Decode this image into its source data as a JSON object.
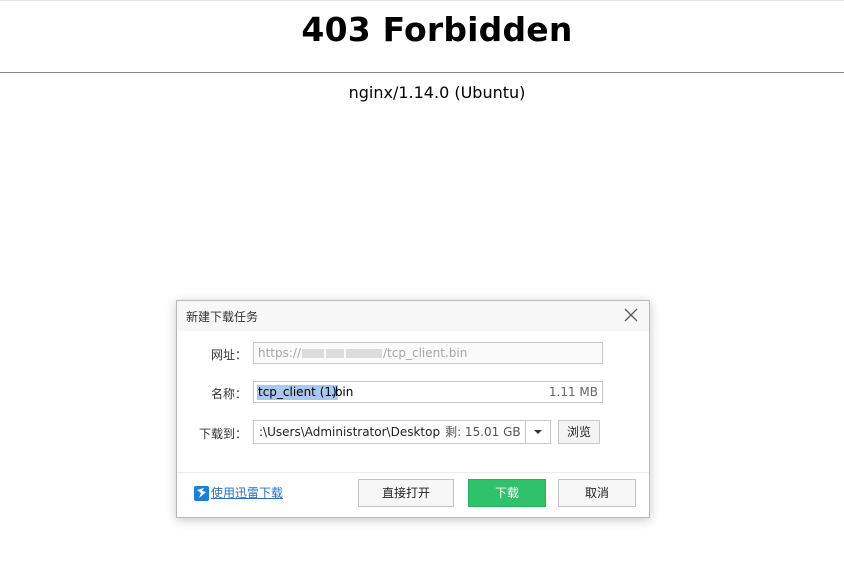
{
  "page": {
    "title": "403 Forbidden",
    "server": "nginx/1.14.0 (Ubuntu)"
  },
  "dialog": {
    "title": "新建下载任务",
    "url_label": "网址：",
    "url_prefix": "https://",
    "url_suffix": "/tcp_client.bin",
    "name_label": "名称：",
    "name_selected": "tcp_client (1)",
    "name_ext": ".bin",
    "file_size": "1.11 MB",
    "path_label": "下载到：",
    "path_value": ":\\Users\\Administrator\\Desktop",
    "free_space": "剩: 15.01 GB",
    "browse_label": "浏览",
    "xunlei_link": "使用迅雷下载",
    "direct_open_label": "直接打开",
    "download_label": "下载",
    "cancel_label": "取消",
    "colors": {
      "accent_green": "#2fc26b",
      "link_blue": "#2a6fbd",
      "selection": "#a8c8f0"
    },
    "icons": {
      "close": "close-icon",
      "dropdown": "chevron-down-icon",
      "xunlei": "xunlei-logo-icon"
    }
  }
}
